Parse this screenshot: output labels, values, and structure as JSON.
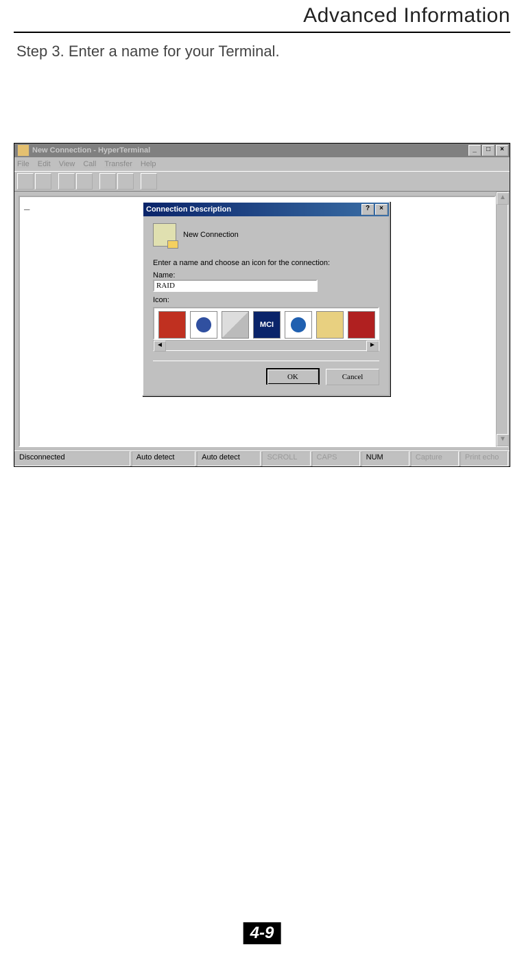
{
  "page": {
    "header_title": "Advanced Information",
    "step_text": "Step 3.  Enter a name for your Terminal.",
    "page_number": "4-9"
  },
  "window": {
    "title": "New Connection - HyperTerminal",
    "menus": {
      "file": "File",
      "edit": "Edit",
      "view": "View",
      "call": "Call",
      "transfer": "Transfer",
      "help": "Help"
    },
    "terminal_cursor": "_"
  },
  "status": {
    "conn": "Disconnected",
    "auto1": "Auto detect",
    "auto2": "Auto detect",
    "scroll": "SCROLL",
    "caps": "CAPS",
    "num": "NUM",
    "capture": "Capture",
    "print": "Print echo"
  },
  "dialog": {
    "title": "Connection Description",
    "new_connection": "New Connection",
    "prompt": "Enter a name and choose an icon for the connection:",
    "name_label": "Name:",
    "name_value": "RAID",
    "icon_label": "Icon:",
    "mci": "MCI",
    "ok": "OK",
    "cancel": "Cancel",
    "help_btn": "?",
    "close_btn": "×"
  },
  "winbtns": {
    "min": "_",
    "max": "□",
    "close": "×"
  },
  "scroll": {
    "up": "▲",
    "down": "▼",
    "left": "◄",
    "right": "►"
  }
}
